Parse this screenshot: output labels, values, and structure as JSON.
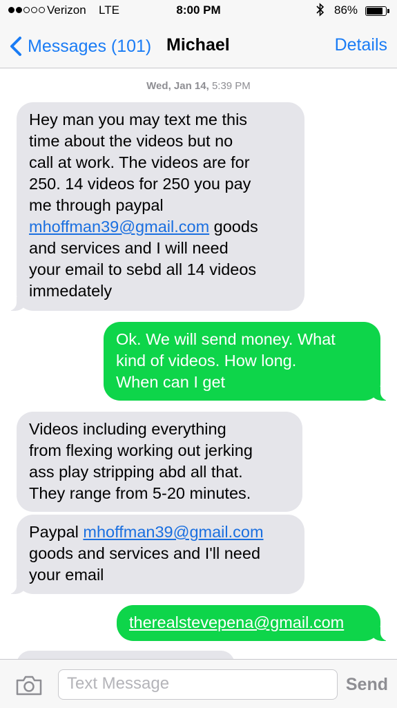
{
  "status_bar": {
    "signal_bars": 5,
    "signal_filled": 2,
    "carrier": "Verizon",
    "network": "LTE",
    "time": "8:00 PM",
    "bluetooth_icon": "bluetooth-icon",
    "battery_percent": "86%",
    "battery_level": 0.86
  },
  "nav": {
    "back_label": "Messages (101)",
    "contact_name": "Michael",
    "details_label": "Details"
  },
  "timestamp": {
    "date": "Wed, Jan 14,",
    "time": "5:39 PM"
  },
  "messages": [
    {
      "direction": "received",
      "lines": [
        "Hey man you may text me this",
        "time about the videos but no",
        "call at work. The videos are for",
        "250. 14 videos for 250 you pay",
        "me through paypal",
        {
          "link": "mhoffman39@gmail.com",
          "after": " goods"
        },
        "and services and I will need",
        "your email to sebd all 14 videos",
        "immedately"
      ]
    },
    {
      "direction": "sent",
      "lines": [
        "Ok. We will send money. What",
        "kind of videos.  How long.",
        "When can I get"
      ]
    },
    {
      "direction": "received",
      "lines": [
        "Videos including everything",
        "from flexing working out jerking",
        "ass play stripping abd all that.",
        "They range from 5-20 minutes."
      ]
    },
    {
      "direction": "received",
      "lines": [
        {
          "before": "Paypal ",
          "link": "mhoffman39@gmail.com"
        },
        "goods and services and I'll need",
        "your email"
      ]
    },
    {
      "direction": "sent",
      "lines": [
        {
          "link": "therealstevepena@gmail.com"
        }
      ]
    }
  ],
  "input": {
    "camera_icon": "camera-icon",
    "placeholder": "Text Message",
    "send_label": "Send"
  },
  "colors": {
    "accent": "#1a7cf5",
    "sent_bubble": "#0ed54a",
    "received_bubble": "#e5e5ea"
  }
}
